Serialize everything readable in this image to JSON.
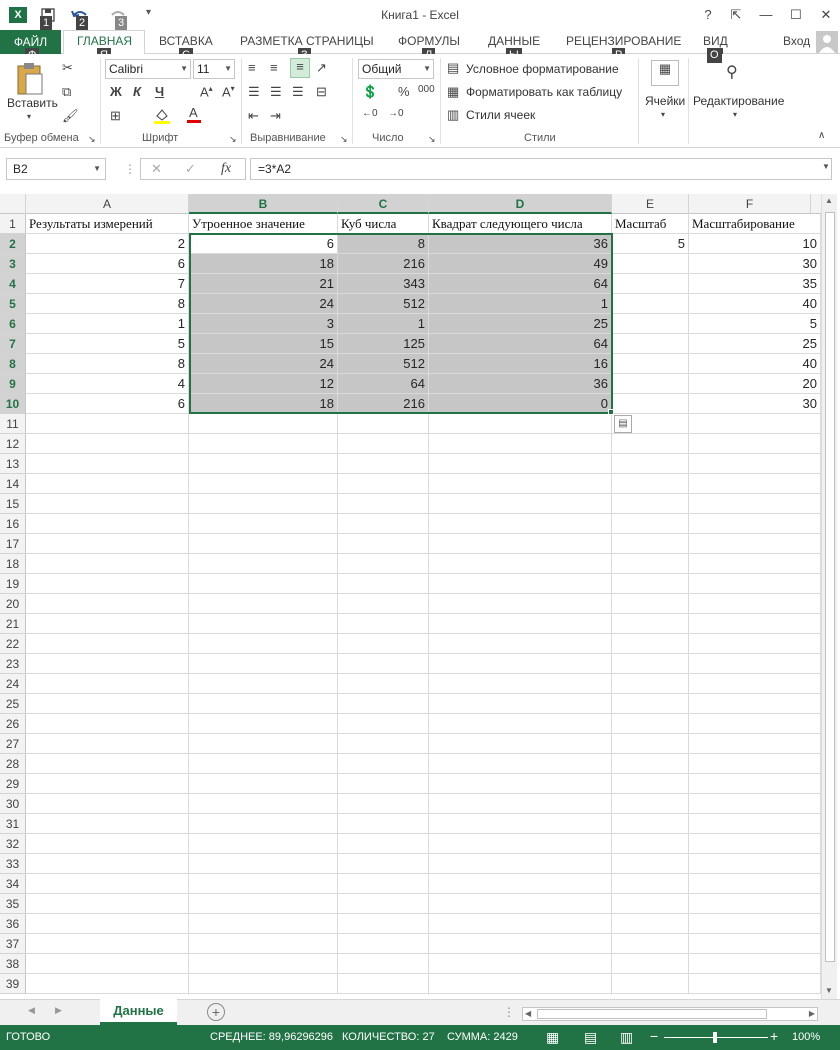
{
  "title": "Книга1 - Excel",
  "quick_access_keytips": [
    "1",
    "2",
    "3"
  ],
  "window_controls": {
    "help": "?",
    "restore_ribbon": "⇱",
    "minimize": "—",
    "maximize": "☐",
    "close": "✕"
  },
  "tabs": {
    "file": "ФАЙЛ",
    "items": [
      "ГЛАВНАЯ",
      "ВСТАВКА",
      "РАЗМЕТКА СТРАНИЦЫ",
      "ФОРМУЛЫ",
      "ДАННЫЕ",
      "РЕЦЕНЗИРОВАНИЕ",
      "ВИД"
    ],
    "signin": "Вход",
    "keytips": {
      "file": "Ф",
      "home": "Я",
      "insert": "С",
      "layout": "З",
      "formulas": "Л",
      "data": "Ы",
      "review": "Р",
      "view": "О"
    }
  },
  "ribbon": {
    "clipboard": {
      "label": "Буфер обмена",
      "paste": "Вставить"
    },
    "font": {
      "label": "Шрифт",
      "name": "Calibri",
      "size": "11",
      "bold": "Ж",
      "italic": "К",
      "underline": "Ч"
    },
    "alignment": {
      "label": "Выравнивание"
    },
    "number": {
      "label": "Число",
      "format": "Общий",
      "percent": "%",
      "thousands": "000"
    },
    "styles": {
      "label": "Стили",
      "conditional": "Условное форматирование",
      "as_table": "Форматировать как таблицу",
      "cell_styles": "Стили ячеек"
    },
    "cells": {
      "label": "Ячейки"
    },
    "editing": {
      "label": "Редактирование"
    }
  },
  "formula_bar": {
    "name_box": "B2",
    "formula": "=3*A2",
    "fx": "fx"
  },
  "columns": [
    "A",
    "B",
    "C",
    "D",
    "E",
    "F"
  ],
  "rows": [
    {
      "n": "1",
      "A": "Результаты измерений",
      "B": "Утроенное значение",
      "C": "Куб числа",
      "D": "Квадрат следующего числа",
      "E": "Масштаб",
      "F": "Масштабирование"
    },
    {
      "n": "2",
      "A": "2",
      "B": "6",
      "C": "8",
      "D": "36",
      "E": "5",
      "F": "10"
    },
    {
      "n": "3",
      "A": "6",
      "B": "18",
      "C": "216",
      "D": "49",
      "E": "",
      "F": "30"
    },
    {
      "n": "4",
      "A": "7",
      "B": "21",
      "C": "343",
      "D": "64",
      "E": "",
      "F": "35"
    },
    {
      "n": "5",
      "A": "8",
      "B": "24",
      "C": "512",
      "D": "1",
      "E": "",
      "F": "40"
    },
    {
      "n": "6",
      "A": "1",
      "B": "3",
      "C": "1",
      "D": "25",
      "E": "",
      "F": "5"
    },
    {
      "n": "7",
      "A": "5",
      "B": "15",
      "C": "125",
      "D": "64",
      "E": "",
      "F": "25"
    },
    {
      "n": "8",
      "A": "8",
      "B": "24",
      "C": "512",
      "D": "16",
      "E": "",
      "F": "40"
    },
    {
      "n": "9",
      "A": "4",
      "B": "12",
      "C": "64",
      "D": "36",
      "E": "",
      "F": "20"
    },
    {
      "n": "10",
      "A": "6",
      "B": "18",
      "C": "216",
      "D": "0",
      "E": "",
      "F": "30"
    }
  ],
  "empty_rows": [
    "11",
    "12",
    "13",
    "14",
    "15",
    "16",
    "17",
    "18",
    "19",
    "20",
    "21",
    "22",
    "23",
    "24",
    "25",
    "26",
    "27",
    "28",
    "29",
    "30",
    "31",
    "32",
    "33",
    "34",
    "35",
    "36",
    "37",
    "38",
    "39"
  ],
  "sheet": {
    "name": "Данные"
  },
  "status": {
    "ready": "ГОТОВО",
    "average": "СРЕДНЕЕ: 89,96296296",
    "count": "КОЛИЧЕСТВО: 27",
    "sum": "СУММА: 2429",
    "zoom": "100%"
  },
  "colors": {
    "accent": "#217346",
    "selection": "#c6c6c6"
  }
}
